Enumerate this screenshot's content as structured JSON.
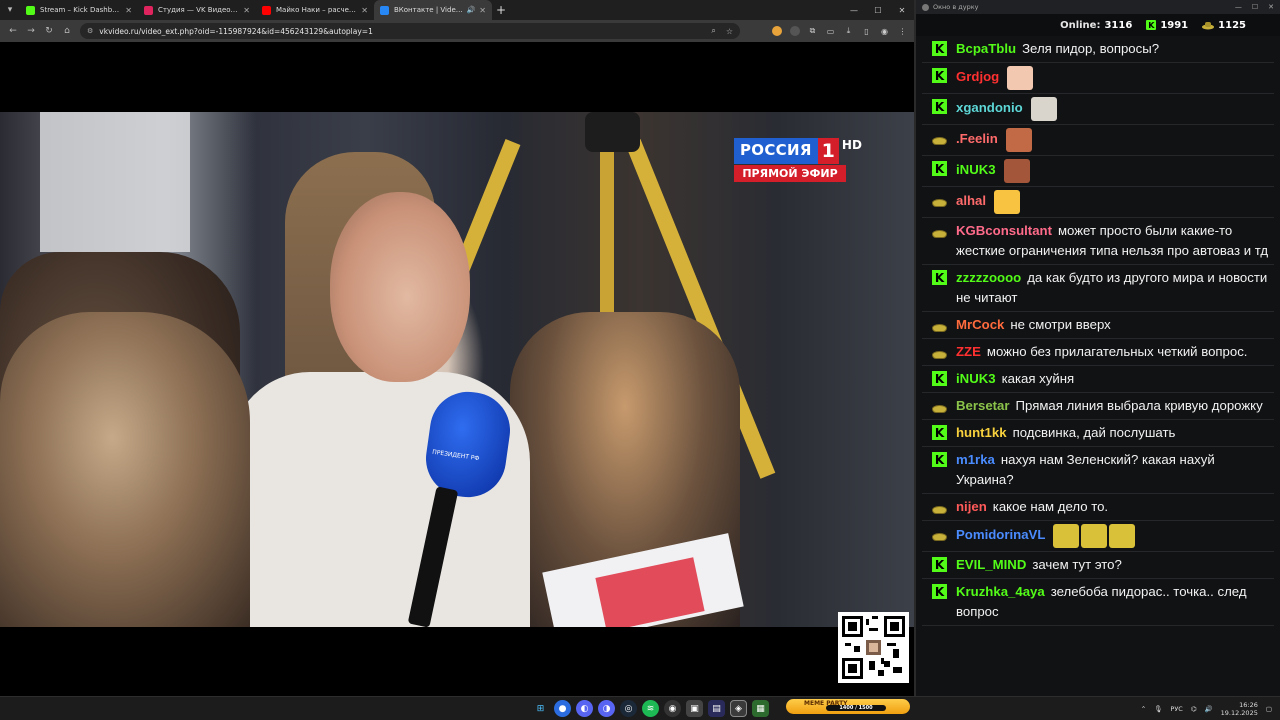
{
  "browser": {
    "tabs": [
      {
        "title": "Stream – Kick Dashboard",
        "favicon_color": "#53fc18",
        "active": false
      },
      {
        "title": "Студия — VK Видео Live",
        "favicon_color": "#e0245e",
        "active": false
      },
      {
        "title": "Майко Наки – расчеловечива...",
        "favicon_color": "#ff0000",
        "active": false
      },
      {
        "title": "ВКонтакте | Video Ext",
        "favicon_color": "#2787f5",
        "active": true
      }
    ],
    "url": "vkvideo.ru/video_ext.php?oid=-115987924&id=456243129&autoplay=1"
  },
  "broadcast": {
    "channel_name": "РОССИЯ",
    "channel_number": "1",
    "hd": "HD",
    "live_label": "ПРЯМОЙ ЭФИР",
    "mic_label": "ПРЕЗИДЕНТ РФ"
  },
  "chat_window": {
    "title": "Окно в дурку",
    "online_label": "Online:",
    "online_count": "3116",
    "kick_count": "1991",
    "vk_count": "1125"
  },
  "chat_messages": [
    {
      "platform": "kick",
      "user": "ВсраТblu",
      "user_color": "#53fc18",
      "text": "Зеля пидор, вопросы?"
    },
    {
      "platform": "kick",
      "user": "Grdjog",
      "user_color": "#ff3030",
      "text": "",
      "emotes": [
        "#f2c8b0"
      ]
    },
    {
      "platform": "kick",
      "user": "xgandonio",
      "user_color": "#5dd6d6",
      "text": "",
      "emotes": [
        "#d9d4cc"
      ]
    },
    {
      "platform": "vk",
      "user": ".Feelin",
      "user_color": "#ff6b6b",
      "text": "",
      "emotes": [
        "#c26a45"
      ]
    },
    {
      "platform": "kick",
      "user": "iNUK3",
      "user_color": "#53fc18",
      "text": "",
      "emotes": [
        "#a3563a"
      ]
    },
    {
      "platform": "vk",
      "user": "alhal",
      "user_color": "#ff6b6b",
      "text": "",
      "emotes": [
        "#f7c341"
      ]
    },
    {
      "platform": "vk",
      "user": "KGBconsultant",
      "user_color": "#ff6b8a",
      "text": "может просто были какие-то жесткие ограничения типа нельзя про автоваз и тд"
    },
    {
      "platform": "kick",
      "user": "zzzzzoooo",
      "user_color": "#53fc18",
      "text": "да как будто из другого мира и новости не читают"
    },
    {
      "platform": "vk",
      "user": "MrCock",
      "user_color": "#ff6b3d",
      "text": "не смотри вверх"
    },
    {
      "platform": "vk",
      "user": "ZZE",
      "user_color": "#ff3030",
      "text": "можно без прилагательных четкий вопрос."
    },
    {
      "platform": "kick",
      "user": "iNUK3",
      "user_color": "#53fc18",
      "text": "какая хуйня"
    },
    {
      "platform": "vk",
      "user": "Bersetar",
      "user_color": "#8bc34a",
      "text": "Прямая линия выбрала кривую дорожку"
    },
    {
      "platform": "kick",
      "user": "hunt1kk",
      "user_color": "#f7d13d",
      "text": "подсвинка, дай послушать"
    },
    {
      "platform": "kick",
      "user": "m1rka",
      "user_color": "#4a8cff",
      "text": "нахуя нам Зеленский? какая нахуй Украина?"
    },
    {
      "platform": "vk",
      "user": "nijen",
      "user_color": "#ff5a5a",
      "text": "какое нам дело то."
    },
    {
      "platform": "vk",
      "user": "PomidorinaVL",
      "user_color": "#4a8cff",
      "text": "",
      "emotes": [
        "#d9c13a",
        "#d9c13a",
        "#d9c13a"
      ]
    },
    {
      "platform": "kick",
      "user": "EVIL_MIND",
      "user_color": "#53fc18",
      "text": "зачем тут это?"
    },
    {
      "platform": "kick",
      "user": "Kruzhka_4aya",
      "user_color": "#53fc18",
      "text": "зелебоба пидорас.. точка.. след вопрос"
    }
  ],
  "taskbar": {
    "meme_party_label": "MEME PARTY",
    "meme_party_progress_text": "1400 / 1500",
    "language": "РУС",
    "time": "16:26",
    "date": "19.12.2025"
  },
  "colors": {
    "kick_green": "#53fc18",
    "russia1_blue": "#1f5fd0",
    "russia1_red": "#d41f2a"
  }
}
